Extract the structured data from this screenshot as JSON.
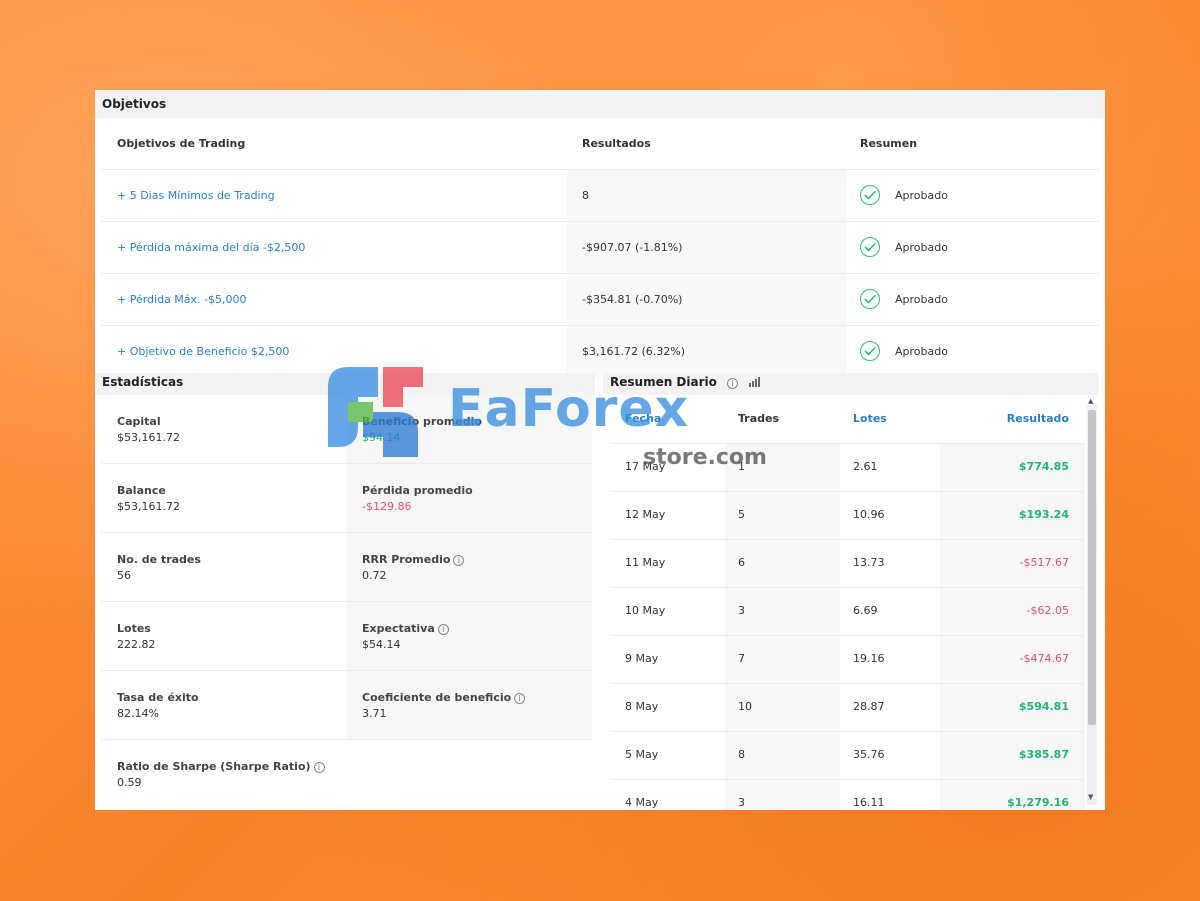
{
  "objetivos": {
    "title": "Objetivos",
    "headers": [
      "Objetivos de Trading",
      "Resultados",
      "Resumen"
    ],
    "rows": [
      {
        "objective": "+ 5 Dias Mínimos de Trading",
        "result": "8",
        "status": "Aprobado"
      },
      {
        "objective": "+ Pérdida máxima del día -$2,500",
        "result": "-$907.07 (-1.81%)",
        "status": "Aprobado"
      },
      {
        "objective": "+ Pérdida Máx. -$5,000",
        "result": "-$354.81 (-0.70%)",
        "status": "Aprobado"
      },
      {
        "objective": "+ Objetivo de Beneficio $2,500",
        "result": "$3,161.72 (6.32%)",
        "status": "Aprobado"
      }
    ]
  },
  "estadisticas": {
    "title": "Estadísticas",
    "capital_label": "Capital",
    "capital": "$53,161.72",
    "beneficio_label": "Beneficio promedio",
    "beneficio": "$94.14",
    "balance_label": "Balance",
    "balance": "$53,161.72",
    "perdida_label": "Pérdida promedio",
    "perdida": "-$129.86",
    "trades_label": "No. de trades",
    "trades": "56",
    "rrr_label": "RRR Promedio",
    "rrr": "0.72",
    "lotes_label": "Lotes",
    "lotes": "222.82",
    "expectativa_label": "Expectativa",
    "expectativa": "$54.14",
    "tasa_label": "Tasa de éxito",
    "tasa": "82.14%",
    "coef_label": "Coeficiente de beneficio",
    "coef": "3.71",
    "sharpe_label": "Ratio de Sharpe (Sharpe Ratio)",
    "sharpe": "0.59"
  },
  "resumen_diario": {
    "title": "Resumen Diario",
    "headers": [
      "Fecha",
      "Trades",
      "Lotes",
      "Resultado"
    ],
    "rows": [
      {
        "fecha": "17 May",
        "trades": "1",
        "lotes": "2.61",
        "resultado": "$774.85"
      },
      {
        "fecha": "12 May",
        "trades": "5",
        "lotes": "10.96",
        "resultado": "$193.24"
      },
      {
        "fecha": "11 May",
        "trades": "6",
        "lotes": "13.73",
        "resultado": "-$517.67"
      },
      {
        "fecha": "10 May",
        "trades": "3",
        "lotes": "6.69",
        "resultado": "-$62.05"
      },
      {
        "fecha": "9 May",
        "trades": "7",
        "lotes": "19.16",
        "resultado": "-$474.67"
      },
      {
        "fecha": "8 May",
        "trades": "10",
        "lotes": "28.87",
        "resultado": "$594.81"
      },
      {
        "fecha": "5 May",
        "trades": "8",
        "lotes": "35.76",
        "resultado": "$385.87"
      },
      {
        "fecha": "4 May",
        "trades": "3",
        "lotes": "16.11",
        "resultado": "$1,279.16"
      }
    ]
  },
  "watermark": {
    "brand": "EaForex",
    "sub": "store.com"
  },
  "colors": {
    "positive": "#22b573",
    "negative": "#e0526b",
    "link": "#2a7fc6",
    "background": "#f4842c"
  }
}
